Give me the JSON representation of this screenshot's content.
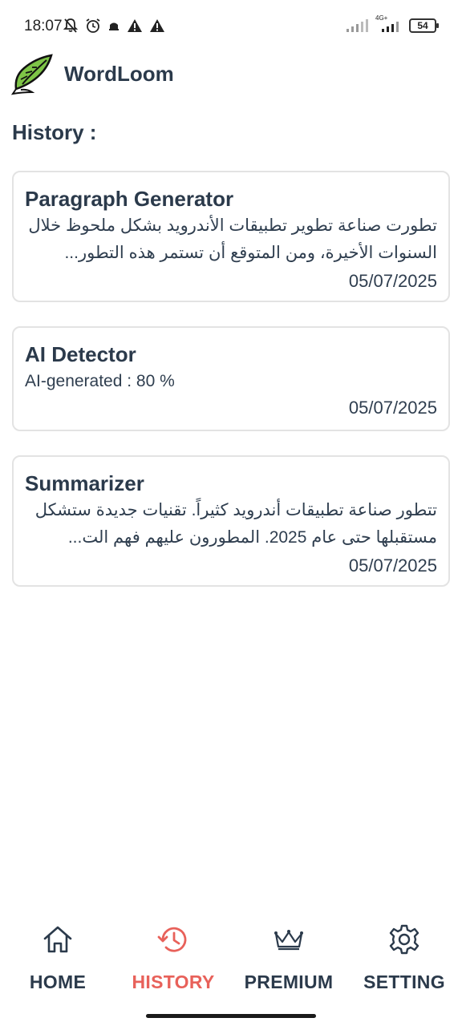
{
  "status_bar": {
    "time": "18:07",
    "battery": "54",
    "network": "4G+"
  },
  "app": {
    "title": "WordLoom",
    "logo_icon": "feather-quill-icon"
  },
  "history": {
    "heading": "History :",
    "items": [
      {
        "title": "Paragraph Generator",
        "lines": [
          "تطورت صناعة تطوير تطبيقات الأندرويد بشكل ملحوظ خلال",
          "السنوات الأخيرة، ومن المتوقع أن تستمر هذه التطور..."
        ],
        "date": "05/07/2025"
      },
      {
        "title": "AI Detector",
        "lines": [
          "AI-generated : 80 %"
        ],
        "date": "05/07/2025"
      },
      {
        "title": "Summarizer",
        "lines": [
          "تتطور صناعة تطبيقات أندرويد كثيراً. تقنيات جديدة ستشكل",
          "مستقبلها حتى عام 2025. المطورون عليهم فهم الت..."
        ],
        "date": "05/07/2025"
      }
    ]
  },
  "bottom_nav": {
    "active": "history",
    "active_color": "#e8615a",
    "inactive_color": "#2b3a4b",
    "items": [
      {
        "label": "HOME",
        "icon": "home-icon"
      },
      {
        "label": "HISTORY",
        "icon": "history-icon"
      },
      {
        "label": "PREMIUM",
        "icon": "crown-icon"
      },
      {
        "label": "SETTING",
        "icon": "gear-icon"
      }
    ]
  }
}
